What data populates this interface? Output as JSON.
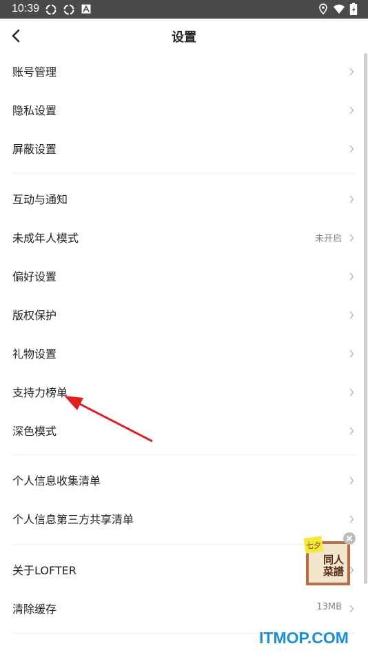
{
  "status_bar": {
    "time": "10:39"
  },
  "header": {
    "title": "设置"
  },
  "groups": [
    {
      "items": [
        {
          "label": "账号管理"
        },
        {
          "label": "隐私设置"
        },
        {
          "label": "屏蔽设置"
        }
      ]
    },
    {
      "items": [
        {
          "label": "互动与通知"
        },
        {
          "label": "未成年人模式",
          "value": "未开启"
        },
        {
          "label": "偏好设置"
        },
        {
          "label": "版权保护"
        },
        {
          "label": "礼物设置"
        },
        {
          "label": "支持力榜单"
        },
        {
          "label": "深色模式"
        }
      ]
    },
    {
      "items": [
        {
          "label": "个人信息收集清单"
        },
        {
          "label": "个人信息第三方共享清单"
        }
      ]
    },
    {
      "items": [
        {
          "label": "关于LOFTER"
        },
        {
          "label": "清除缓存",
          "value": "13MB"
        }
      ]
    }
  ],
  "ad": {
    "text": "同人菜譜",
    "badge": "七夕"
  },
  "watermark": "ITMOP.COM",
  "colors": {
    "status_bar": "#4a4a4a",
    "annotation_arrow": "#e02020",
    "watermark": "#1a8fd6"
  }
}
